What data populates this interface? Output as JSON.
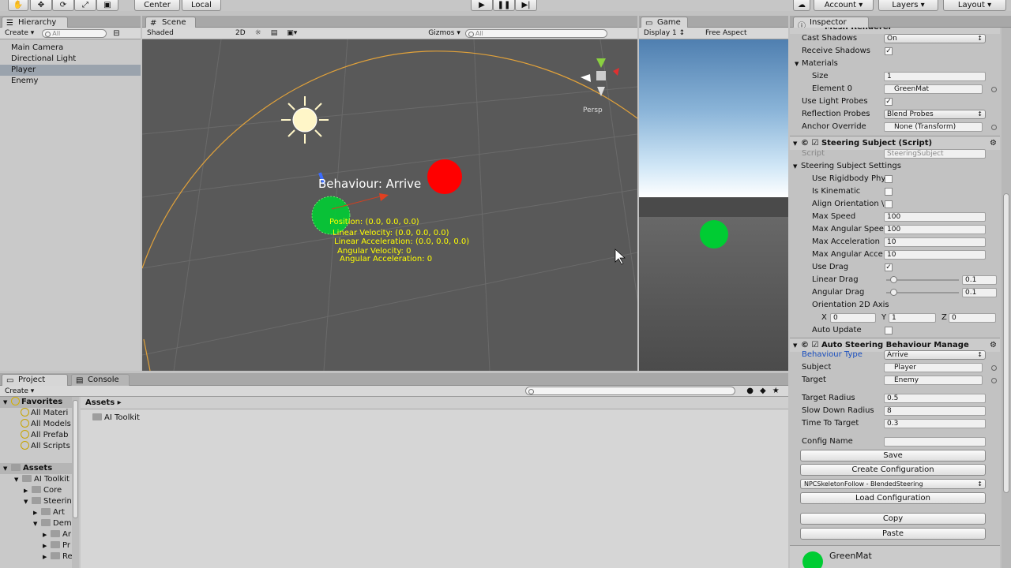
{
  "toolbar": {
    "pivot": "Center",
    "space": "Local",
    "account": "Account",
    "layers": "Layers",
    "layout": "Layout"
  },
  "hierarchy": {
    "tab": "Hierarchy",
    "create": "Create",
    "search": "All",
    "items": [
      "Main Camera",
      "Directional Light",
      "Player",
      "Enemy"
    ],
    "selected": 2
  },
  "scene": {
    "tab": "Scene",
    "shading": "Shaded",
    "mode2d": "2D",
    "gizmos": "Gizmos",
    "search": "All",
    "persp": "Persp",
    "label": "Behaviour: Arrive",
    "info": [
      "Position: (0.0, 0.0, 0.0)",
      "Linear Velocity: (0.0, 0.0, 0.0)",
      "Linear Acceleration: (0.0, 0.0, 0.0)",
      "Angular Velocity: 0",
      "Angular Acceleration: 0"
    ]
  },
  "game": {
    "tab": "Game",
    "display": "Display 1",
    "aspect": "Free Aspect"
  },
  "inspector": {
    "tab": "Inspector",
    "header_cut": "Mesh Renderer",
    "rows": [
      {
        "label": "Cast Shadows",
        "value": "On",
        "kind": "popup"
      },
      {
        "label": "Receive Shadows",
        "kind": "check",
        "checked": "✓"
      },
      {
        "label": "Materials",
        "kind": "fold"
      },
      {
        "label": "Size",
        "value": "1",
        "kind": "field",
        "indent": 1
      },
      {
        "label": "Element 0",
        "value": "GreenMat",
        "kind": "obj",
        "indent": 1
      },
      {
        "label": "Use Light Probes",
        "kind": "check",
        "checked": "✓"
      },
      {
        "label": "Reflection Probes",
        "value": "Blend Probes",
        "kind": "popup"
      },
      {
        "label": "Anchor Override",
        "value": "None (Transform)",
        "kind": "obj"
      }
    ],
    "steering": {
      "title": "Steering Subject (Script)",
      "script_label": "Script",
      "script_value": "SteeringSubject",
      "settings": "Steering Subject Settings",
      "rows": [
        {
          "label": "Use Rigidbody Phy",
          "kind": "check",
          "checked": ""
        },
        {
          "label": "Is Kinematic",
          "kind": "check",
          "checked": ""
        },
        {
          "label": "Align Orientation \\",
          "kind": "check",
          "checked": ""
        },
        {
          "label": "Max Speed",
          "value": "100",
          "kind": "field"
        },
        {
          "label": "Max Angular Spee",
          "value": "100",
          "kind": "field"
        },
        {
          "label": "Max Acceleration",
          "value": "10",
          "kind": "field"
        },
        {
          "label": "Max Angular Acce",
          "value": "10",
          "kind": "field"
        },
        {
          "label": "Use Drag",
          "kind": "check",
          "checked": "✓"
        },
        {
          "label": "Linear Drag",
          "value": "0.1",
          "kind": "slider"
        },
        {
          "label": "Angular Drag",
          "value": "0.1",
          "kind": "slider"
        }
      ],
      "orient_label": "Orientation 2D Axis",
      "x": "0",
      "y": "1",
      "z": "0",
      "xl": "X",
      "yl": "Y",
      "zl": "Z",
      "auto_update": "Auto Update"
    },
    "auto": {
      "title": "Auto Steering Behaviour Manage",
      "rows": [
        {
          "label": "Behaviour Type",
          "value": "Arrive",
          "kind": "popup"
        },
        {
          "label": "Subject",
          "value": "Player",
          "kind": "obj"
        },
        {
          "label": "Target",
          "value": "Enemy",
          "kind": "obj"
        }
      ],
      "rows2": [
        {
          "label": "Target Radius",
          "value": "0.5"
        },
        {
          "label": "Slow Down Radius",
          "value": "8"
        },
        {
          "label": "Time To Target",
          "value": "0.3"
        }
      ],
      "config_label": "Config Name",
      "config_value": "",
      "save": "Save",
      "create": "Create Configuration",
      "preset": "NPCSkeletonFollow - BlendedSteering",
      "load": "Load Configuration",
      "copy": "Copy",
      "paste": "Paste"
    },
    "material": "GreenMat"
  },
  "project": {
    "tab": "Project",
    "console": "Console",
    "create": "Create",
    "favorites": "Favorites",
    "fav_items": [
      "All Materi",
      "All Models",
      "All Prefab",
      "All Scripts"
    ],
    "assets": "Assets",
    "tree": [
      {
        "t": "AI Toolkit",
        "d": 1
      },
      {
        "t": "Core",
        "d": 2
      },
      {
        "t": "Steerin",
        "d": 2
      },
      {
        "t": "Art",
        "d": 3
      },
      {
        "t": "Demo",
        "d": 3
      },
      {
        "t": "Ar",
        "d": 4
      },
      {
        "t": "Pr",
        "d": 4
      },
      {
        "t": "Re",
        "d": 4
      }
    ],
    "crumb": "Assets",
    "folder": "AI Toolkit"
  },
  "colors": {
    "enemy": "#ff0000",
    "player": "#00cc33",
    "label": "#ffff00"
  }
}
